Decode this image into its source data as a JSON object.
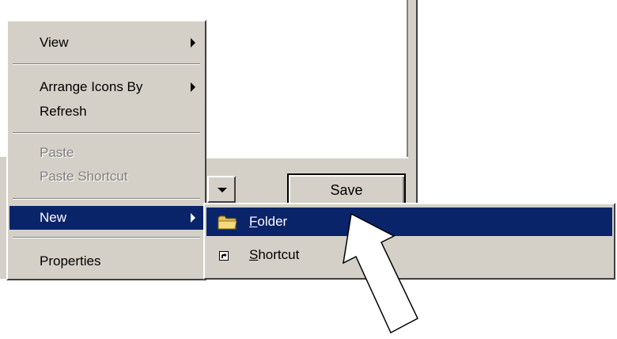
{
  "dialog": {
    "save_label": "Save"
  },
  "context_menu": {
    "items": [
      {
        "label": "View",
        "submenu": true,
        "disabled": false
      },
      {
        "label": "Arrange Icons By",
        "submenu": true,
        "disabled": false
      },
      {
        "label": "Refresh",
        "submenu": false,
        "disabled": false
      },
      {
        "label": "Paste",
        "submenu": false,
        "disabled": true
      },
      {
        "label": "Paste Shortcut",
        "submenu": false,
        "disabled": true
      },
      {
        "label": "New",
        "submenu": true,
        "disabled": false,
        "highlighted": true
      },
      {
        "label": "Properties",
        "submenu": false,
        "disabled": false
      }
    ]
  },
  "submenu": {
    "items": [
      {
        "accel": "F",
        "rest": "older",
        "icon": "folder-icon",
        "highlighted": true
      },
      {
        "accel": "S",
        "rest": "hortcut",
        "icon": "shortcut-icon",
        "highlighted": false
      }
    ]
  },
  "colors": {
    "highlight": "#0a246a",
    "face": "#d4d0c8"
  }
}
